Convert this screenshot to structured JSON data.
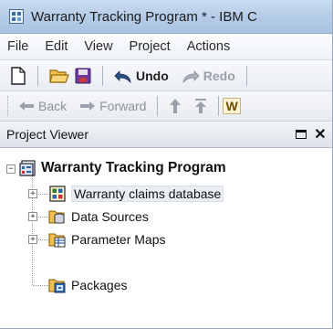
{
  "window": {
    "title": "Warranty Tracking Program * - IBM C"
  },
  "menu": {
    "items": [
      "File",
      "Edit",
      "View",
      "Project",
      "Actions"
    ]
  },
  "toolbar": {
    "undo_label": "Undo",
    "redo_label": "Redo"
  },
  "nav_toolbar": {
    "back_label": "Back",
    "forward_label": "Forward",
    "w_label": "W"
  },
  "pane": {
    "title": "Project Viewer"
  },
  "tree": {
    "root": {
      "label": "Warranty Tracking Program",
      "icon": "project-icon"
    },
    "children": [
      {
        "label": "Warranty claims database",
        "icon": "model-icon",
        "expander": "+"
      },
      {
        "label": "Data Sources",
        "icon": "data-sources-icon",
        "expander": "+"
      },
      {
        "label": "Parameter Maps",
        "icon": "parameter-maps-icon",
        "expander": "+"
      },
      {
        "label": "Packages",
        "icon": "packages-icon"
      }
    ]
  },
  "colors": {
    "title_bar": "#b4cbe6",
    "selection": "#eaeef3"
  }
}
